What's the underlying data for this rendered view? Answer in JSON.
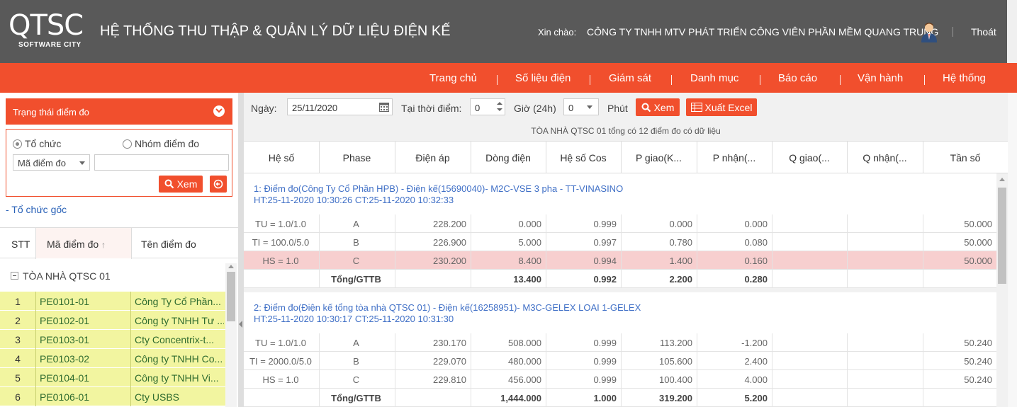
{
  "header": {
    "logo_text": "QTSC",
    "logo_sub": "SOFTWARE CITY",
    "title": "HỆ THỐNG THU THẬP & QUẢN LÝ DỮ LIỆU ĐIỆN KẾ",
    "greeting_label": "Xin chào:",
    "user_name": "CÔNG TY TNHH MTV PHÁT TRIỂN CÔNG VIÊN PHẦN MỀM QUANG TRUNG",
    "logout": "Thoát"
  },
  "nav": {
    "items": [
      "Trang chủ",
      "Số liệu điện",
      "Giám sát",
      "Danh mục",
      "Báo cáo",
      "Vận hành",
      "Hệ thống"
    ]
  },
  "left": {
    "status_title": "Trạng thái điểm đo",
    "radio_org": "Tổ chức",
    "radio_group": "Nhóm điểm đo",
    "search_field_select": "Mã điểm đo",
    "search_placeholder": "",
    "view_button": "Xem",
    "org_root": "- Tổ chức gốc",
    "columns": {
      "stt": "STT",
      "code": "Mã điểm đo",
      "name": "Tên điểm đo"
    },
    "group_name": "TÒA NHÀ QTSC 01",
    "rows": [
      {
        "stt": "1",
        "code": "PE0101-01",
        "name": "Công Ty Cổ Phần..."
      },
      {
        "stt": "2",
        "code": "PE0102-01",
        "name": "Công ty TNHH Tư ..."
      },
      {
        "stt": "3",
        "code": "PE0103-01",
        "name": "Cty Concentrix-t..."
      },
      {
        "stt": "4",
        "code": "PE0103-02",
        "name": "Công ty TNHH Co..."
      },
      {
        "stt": "5",
        "code": "PE0104-01",
        "name": "Công ty TNHH Vi..."
      },
      {
        "stt": "6",
        "code": "PE0106-01",
        "name": "Cty USBS"
      }
    ]
  },
  "toolbar": {
    "date_label": "Ngày:",
    "date_value": "25/11/2020",
    "at_label": "Tại thời điểm:",
    "hour_value": "0",
    "hour_label": "Giờ (24h)",
    "minute_value": "0",
    "minute_label": "Phút",
    "view_button": "Xem",
    "export_button": "Xuất Excel"
  },
  "summary": "TÒA NHÀ QTSC 01 tổng có 12 điểm đo có dữ liệu",
  "table": {
    "columns": [
      "Hệ số",
      "Phase",
      "Điện áp",
      "Dòng điện",
      "Hệ số Cos",
      "P giao(K...",
      "P nhận(...",
      "Q giao(...",
      "Q nhận(...",
      "Tần số"
    ],
    "groups": [
      {
        "title": "1:   Điểm đo(Công Ty Cổ Phần HPB) - Điện kế(15690040)- M2C-VSE 3 pha - TT-VINASINO",
        "subtitle": "HT:25-11-2020 10:30:26   CT:25-11-2020 10:32:33",
        "rows": [
          [
            "TU = 1.0/1.0",
            "A",
            "228.200",
            "0.000",
            "0.999",
            "0.000",
            "0.000",
            "",
            "",
            "50.000"
          ],
          [
            "TI = 100.0/5.0",
            "B",
            "226.900",
            "5.000",
            "0.997",
            "0.780",
            "0.080",
            "",
            "",
            "50.000"
          ],
          [
            "HS = 1.0",
            "C",
            "230.200",
            "8.400",
            "0.994",
            "1.400",
            "0.160",
            "",
            "",
            "50.000"
          ],
          [
            "",
            "Tổng/GTTB",
            "",
            "13.400",
            "0.992",
            "2.200",
            "0.280",
            "",
            "",
            ""
          ]
        ]
      },
      {
        "title": "2:   Điểm đo(Điện kế tổng tòa nhà QTSC 01) - Điện kế(16258951)- M3C-GELEX LOAI 1-GELEX",
        "subtitle": "HT:25-11-2020 10:30:17   CT:25-11-2020 10:31:30",
        "rows": [
          [
            "TU = 1.0/1.0",
            "A",
            "230.170",
            "508.000",
            "0.999",
            "113.200",
            "-1.200",
            "",
            "",
            "50.240"
          ],
          [
            "TI = 2000.0/5.0",
            "B",
            "229.070",
            "480.000",
            "0.999",
            "105.600",
            "2.400",
            "",
            "",
            "50.240"
          ],
          [
            "HS = 1.0",
            "C",
            "229.810",
            "456.000",
            "0.999",
            "100.400",
            "4.000",
            "",
            "",
            "50.240"
          ],
          [
            "",
            "Tổng/GTTB",
            "",
            "1,444.000",
            "1.000",
            "319.200",
            "5.200",
            "",
            "",
            ""
          ]
        ]
      }
    ]
  },
  "colors": {
    "accent": "#f14f2d",
    "header_bg": "#595959",
    "row_yellow": "#f2f5a0",
    "row_highlight": "#f7cfcf",
    "link": "#3f6fc6"
  }
}
